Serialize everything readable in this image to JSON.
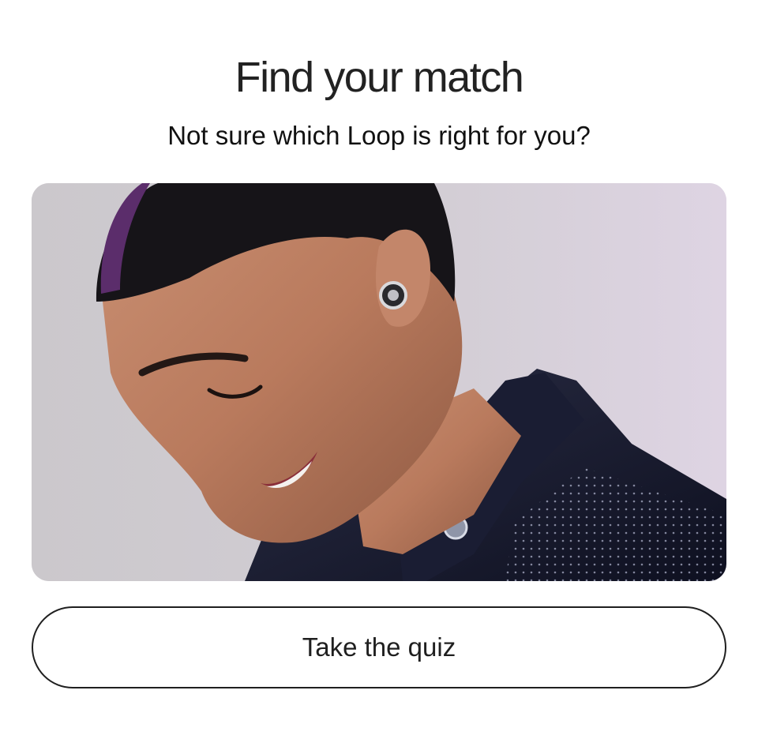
{
  "heading": {
    "title": "Find your match",
    "subtitle": "Not sure which Loop is right for you?"
  },
  "hero_image": {
    "alt": "Man wearing a Loop earplug in a black leather jacket"
  },
  "cta": {
    "label": "Take the quiz"
  },
  "colors": {
    "text": "#1f1f1f",
    "button_border": "#1f1f1f",
    "background": "#ffffff"
  }
}
